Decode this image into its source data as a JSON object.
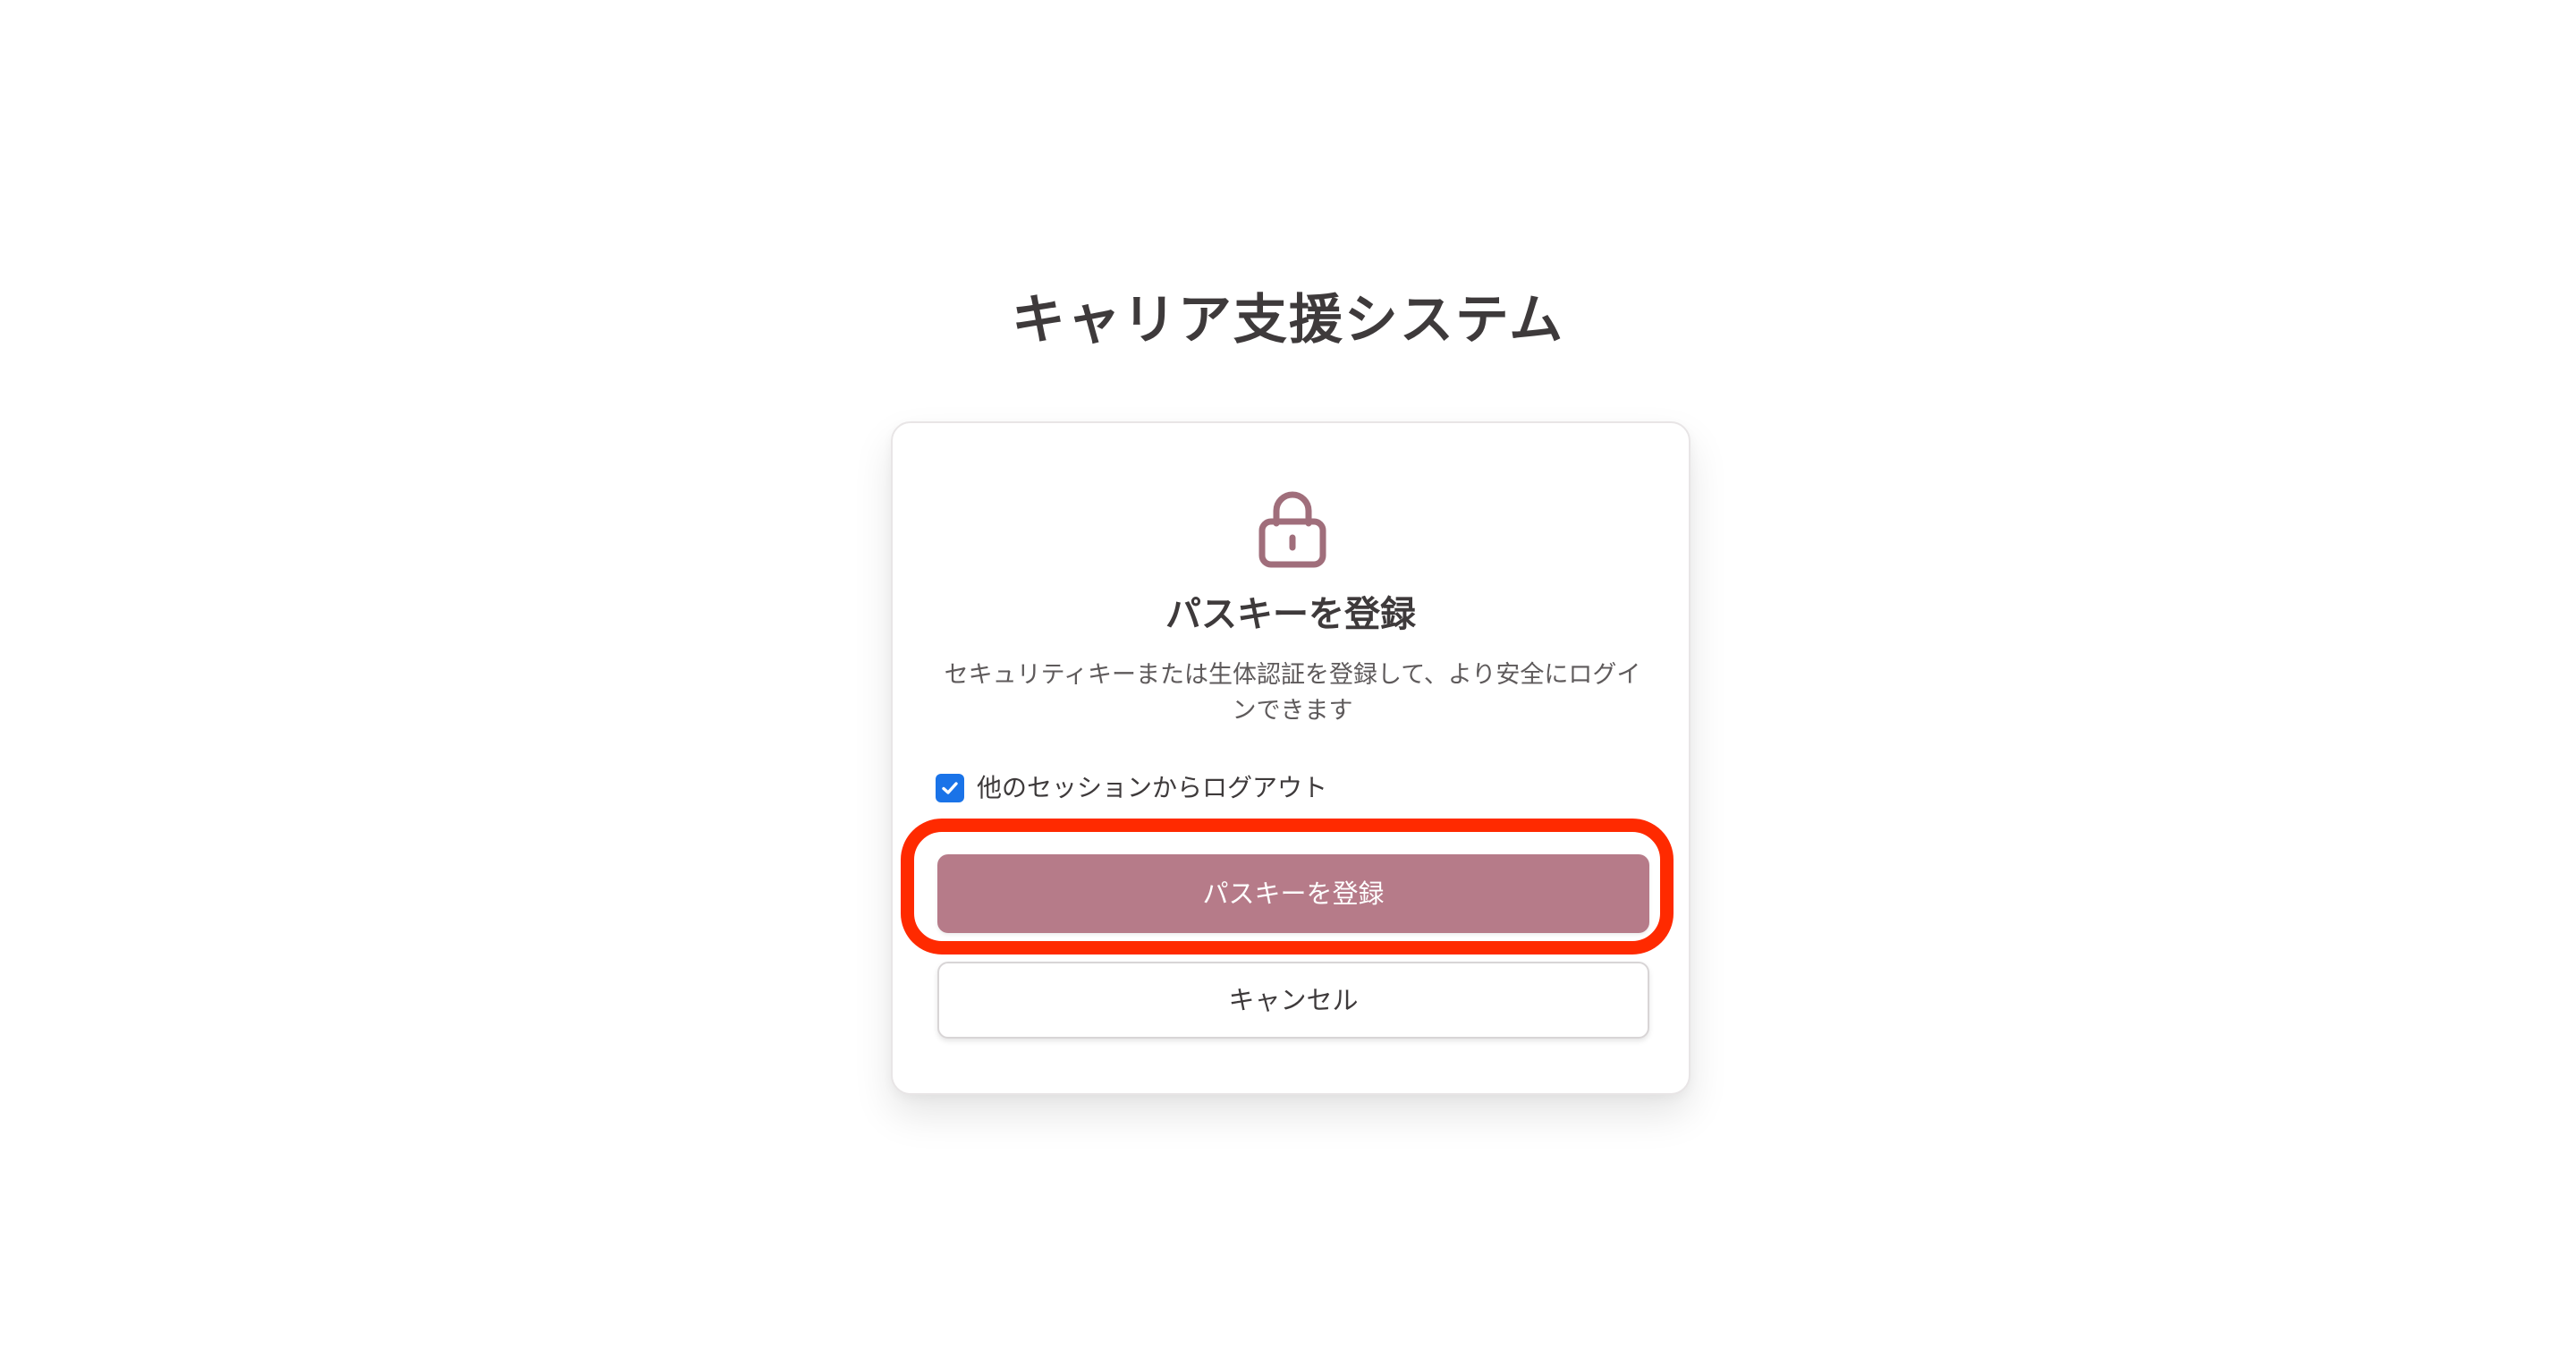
{
  "page": {
    "title": "キャリア支援システム"
  },
  "card": {
    "icon": "lock-icon",
    "title": "パスキーを登録",
    "description": "セキュリティキーまたは生体認証を登録して、より安全にログインできます",
    "logout_checkbox": {
      "label": "他のセッションからログアウト",
      "checked": true
    },
    "primary_button_label": "パスキーを登録",
    "cancel_button_label": "キャンセル"
  },
  "colors": {
    "accent": "#b67b89",
    "highlight": "#ff2a00",
    "checkbox": "#1a73e8",
    "title_text": "#3e3a3b"
  }
}
